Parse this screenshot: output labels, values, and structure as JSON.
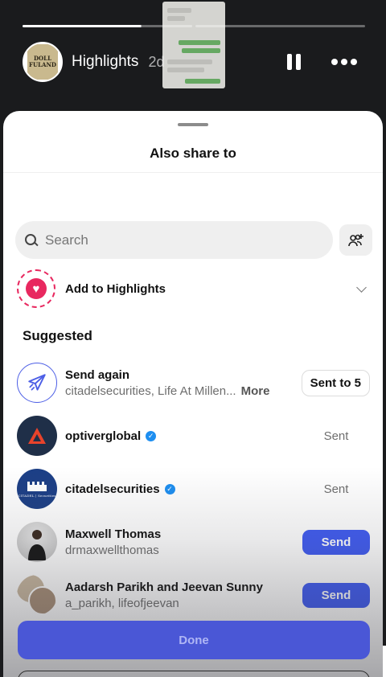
{
  "story": {
    "username": "Highlights",
    "time_ago": "2d",
    "avatar_text_top": "DOLL",
    "avatar_text_bottom": "FULAND",
    "progress": [
      1.0,
      0.7,
      0.0
    ]
  },
  "sheet": {
    "title": "Also share to",
    "search_placeholder": "Search",
    "highlights_label": "Add to Highlights",
    "section_title": "Suggested"
  },
  "rows": [
    {
      "name": "Send again",
      "subtitle": "citadelsecurities, Life At Millen...",
      "more": "More",
      "action": "Sent to 5",
      "action_style": "outline",
      "verified": false
    },
    {
      "name": "optiverglobal",
      "subtitle": "",
      "action": "Sent",
      "action_style": "text",
      "verified": true
    },
    {
      "name": "citadelsecurities",
      "subtitle": "",
      "action": "Sent",
      "action_style": "text",
      "verified": true,
      "logo_text": "CITADEL | Securities"
    },
    {
      "name": "Maxwell Thomas",
      "subtitle": "drmaxwellthomas",
      "action": "Send",
      "action_style": "primary",
      "verified": false
    },
    {
      "name": "Aadarsh Parikh and Jeevan Sunny",
      "subtitle": "a_parikh, lifeofjeevan",
      "action": "Send",
      "action_style": "primary",
      "verified": false
    }
  ],
  "footer": {
    "done_label": "Done"
  },
  "colors": {
    "accent": "#3f5bf2",
    "highlight_pink": "#e8285f",
    "verified": "#1d8ef0",
    "optiver_bg": "#1f2f48",
    "citadel_bg": "#1c3f86"
  }
}
